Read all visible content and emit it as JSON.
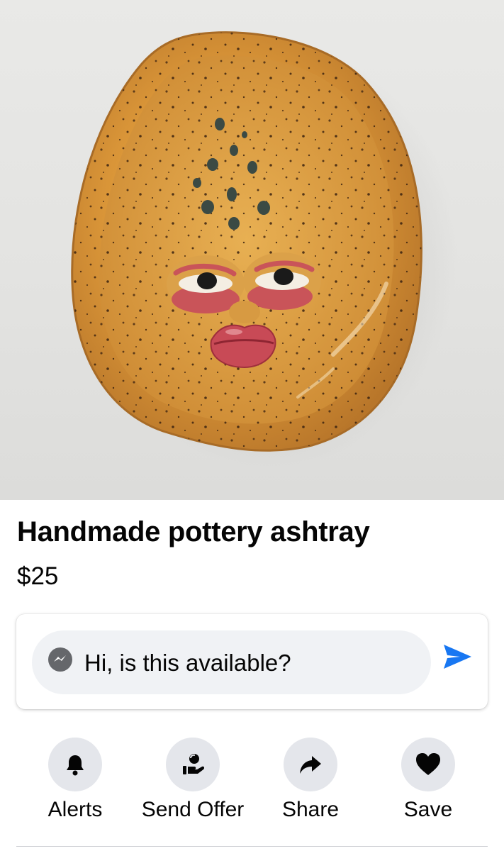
{
  "listing": {
    "title": "Handmade pottery ashtray",
    "price": "$25"
  },
  "message": {
    "text": "Hi, is this available?",
    "icon": "messenger-icon",
    "send_icon": "send-icon"
  },
  "actions": [
    {
      "label": "Alerts",
      "icon": "bell-icon"
    },
    {
      "label": "Send Offer",
      "icon": "offer-hand-icon"
    },
    {
      "label": "Share",
      "icon": "share-arrow-icon"
    },
    {
      "label": "Save",
      "icon": "heart-icon"
    }
  ],
  "colors": {
    "accent": "#1877f2",
    "input_bg": "#f0f2f5",
    "icon_circle_bg": "#e4e6eb"
  }
}
